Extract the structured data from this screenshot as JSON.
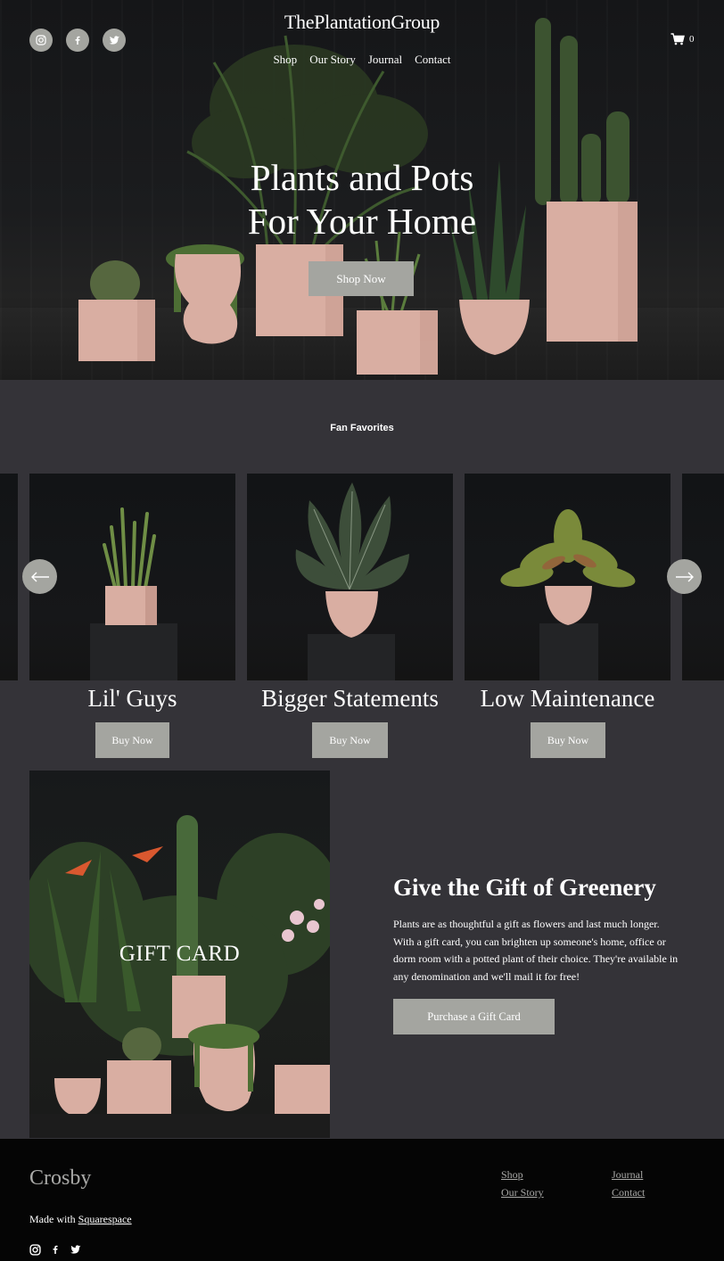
{
  "header": {
    "brand": "ThePlantationGroup",
    "nav": [
      "Shop",
      "Our Story",
      "Journal",
      "Contact"
    ],
    "cart_count": "0",
    "social_icons": [
      "instagram-icon",
      "facebook-icon",
      "twitter-icon"
    ]
  },
  "hero": {
    "title_line1": "Plants and Pots",
    "title_line2": "For Your Home",
    "cta": "Shop Now"
  },
  "favorites": {
    "heading": "Fan Favorites",
    "items": [
      {
        "title": "Lil' Guys",
        "cta": "Buy Now"
      },
      {
        "title": "Bigger Statements",
        "cta": "Buy Now"
      },
      {
        "title": "Low Maintenance",
        "cta": "Buy Now"
      }
    ]
  },
  "gift": {
    "image_label": "GIFT CARD",
    "title": "Give the Gift of Greenery",
    "body": "Plants are as thoughtful a gift as flowers and last much longer. With a gift card, you can brighten up someone's home, office or dorm room with a potted plant of their choice. They're available in any denomination and we'll mail it for free!",
    "cta": "Purchase a Gift Card"
  },
  "footer": {
    "logo": "Crosby",
    "made_with": "Made with",
    "made_with_link": "Squarespace",
    "links_col1": [
      "Shop",
      "Our Story"
    ],
    "links_col2": [
      "Journal",
      "Contact"
    ]
  },
  "colors": {
    "page_bg": "#343338",
    "button": "#a4a5a0",
    "footer_bg": "#050505",
    "pot_pink": "#d9aea2"
  }
}
